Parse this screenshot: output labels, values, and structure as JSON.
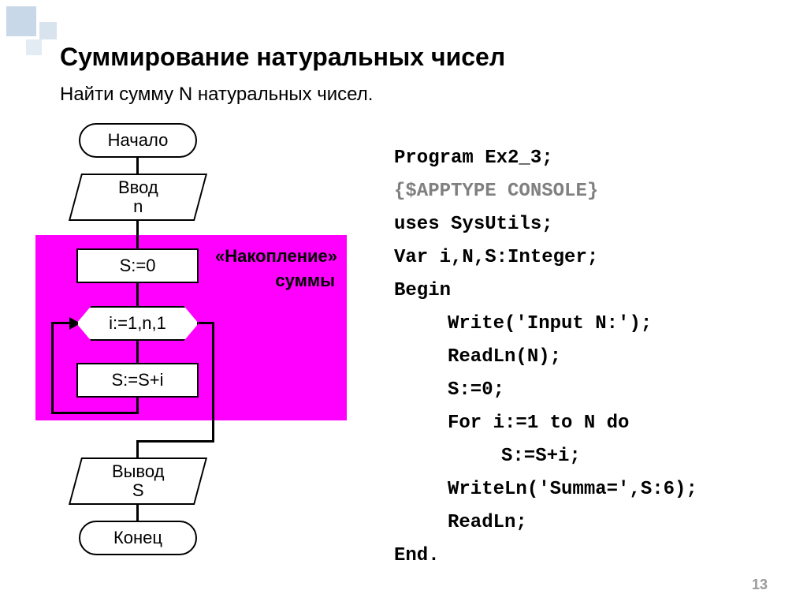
{
  "title": "Суммирование натуральных чисел",
  "subtitle": "Найти сумму N натуральных чисел.",
  "flowchart": {
    "start": "Начало",
    "input": "Ввод\nn",
    "init": "S:=0",
    "loop": "i:=1,n,1",
    "body": "S:=S+i",
    "output": "Вывод\nS",
    "end": "Конец",
    "annotation": "«Накопление»\n            суммы"
  },
  "code": {
    "l1": "Program Ex2_3;",
    "l2": "{$APPTYPE CONSOLE}",
    "l3": "uses  SysUtils;",
    "l4": "Var i,N,S:Integer;",
    "l5": "Begin",
    "l6": "Write('Input N:');",
    "l7": "ReadLn(N);",
    "l8": "S:=0;",
    "l9": "For i:=1 to N do",
    "l10": "S:=S+i;",
    "l11": "WriteLn('Summa=',S:6);",
    "l12": "ReadLn;",
    "l13": "End."
  },
  "page_number": "13"
}
